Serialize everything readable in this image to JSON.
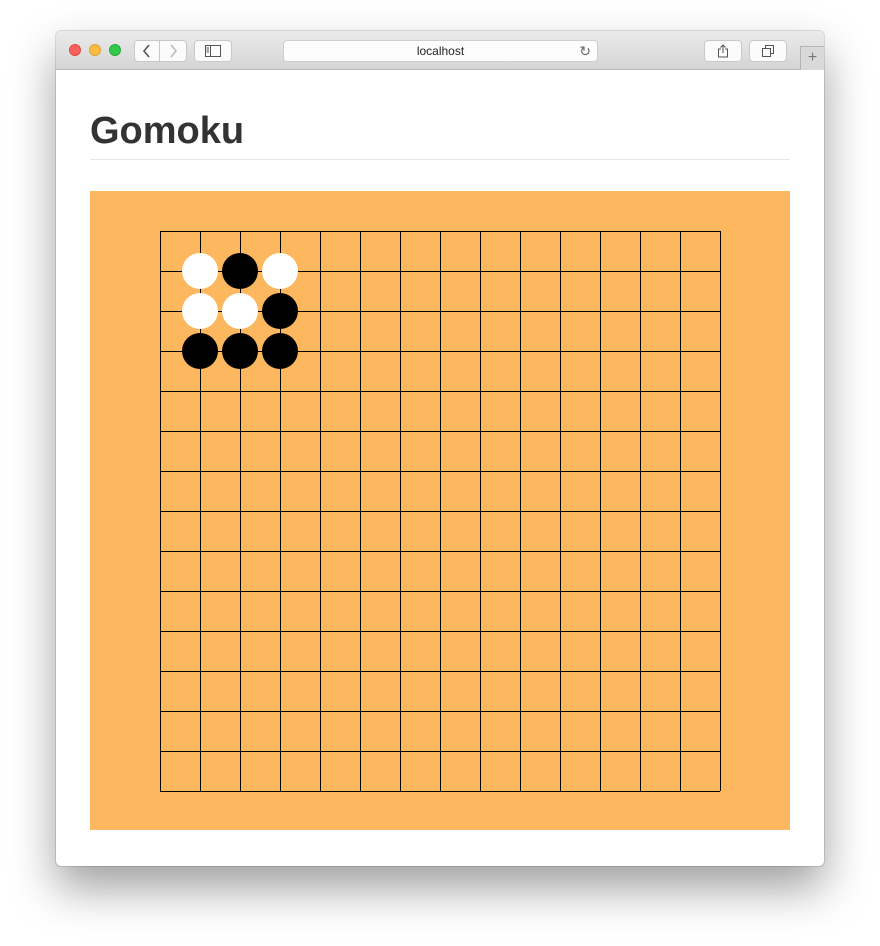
{
  "browser": {
    "address": "localhost"
  },
  "page": {
    "title": "Gomoku"
  },
  "board": {
    "rows": 14,
    "cols": 14,
    "background": "#fdb85f",
    "line_color": "#000000",
    "stones": [
      {
        "row": 1,
        "col": 1,
        "color": "white"
      },
      {
        "row": 1,
        "col": 2,
        "color": "black"
      },
      {
        "row": 1,
        "col": 3,
        "color": "white"
      },
      {
        "row": 2,
        "col": 1,
        "color": "white"
      },
      {
        "row": 2,
        "col": 2,
        "color": "white"
      },
      {
        "row": 2,
        "col": 3,
        "color": "black"
      },
      {
        "row": 3,
        "col": 1,
        "color": "black"
      },
      {
        "row": 3,
        "col": 2,
        "color": "black"
      },
      {
        "row": 3,
        "col": 3,
        "color": "black"
      }
    ]
  }
}
